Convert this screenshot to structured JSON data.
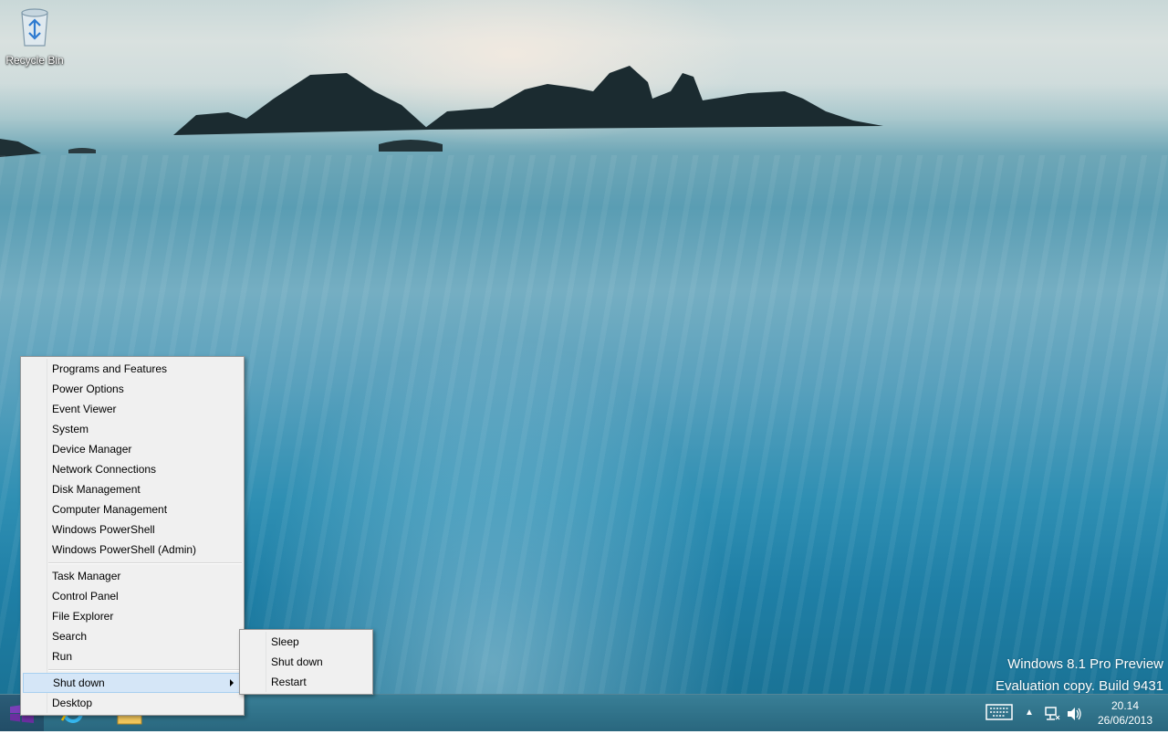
{
  "desktop": {
    "icons": [
      {
        "label": "Recycle Bin",
        "icon": "recycle-bin-icon"
      }
    ],
    "watermark": {
      "line1": "Windows 8.1 Pro Preview",
      "line2": "Evaluation copy. Build 9431"
    }
  },
  "context_menu": {
    "group1": [
      "Programs and Features",
      "Power Options",
      "Event Viewer",
      "System",
      "Device Manager",
      "Network Connections",
      "Disk Management",
      "Computer Management",
      "Windows PowerShell",
      "Windows PowerShell (Admin)"
    ],
    "group2": [
      "Task Manager",
      "Control Panel",
      "File Explorer",
      "Search",
      "Run"
    ],
    "group3": [
      "Shut down",
      "Desktop"
    ]
  },
  "shutdown_submenu": [
    "Sleep",
    "Shut down",
    "Restart"
  ],
  "taskbar": {
    "start_icon": "windows-logo-icon",
    "pinned": [
      "internet-explorer-icon",
      "file-explorer-icon"
    ],
    "tray": {
      "icons": [
        "keyboard-icon",
        "show-hidden-icons-arrow",
        "network-icon",
        "volume-icon"
      ],
      "time": "20.14",
      "date": "26/06/2013"
    }
  },
  "colors": {
    "menu_bg": "#f0f0f0",
    "menu_hover": "#d5e6f7",
    "taskbar": "#2a6e88",
    "start_logo": "#6b2fa0"
  }
}
